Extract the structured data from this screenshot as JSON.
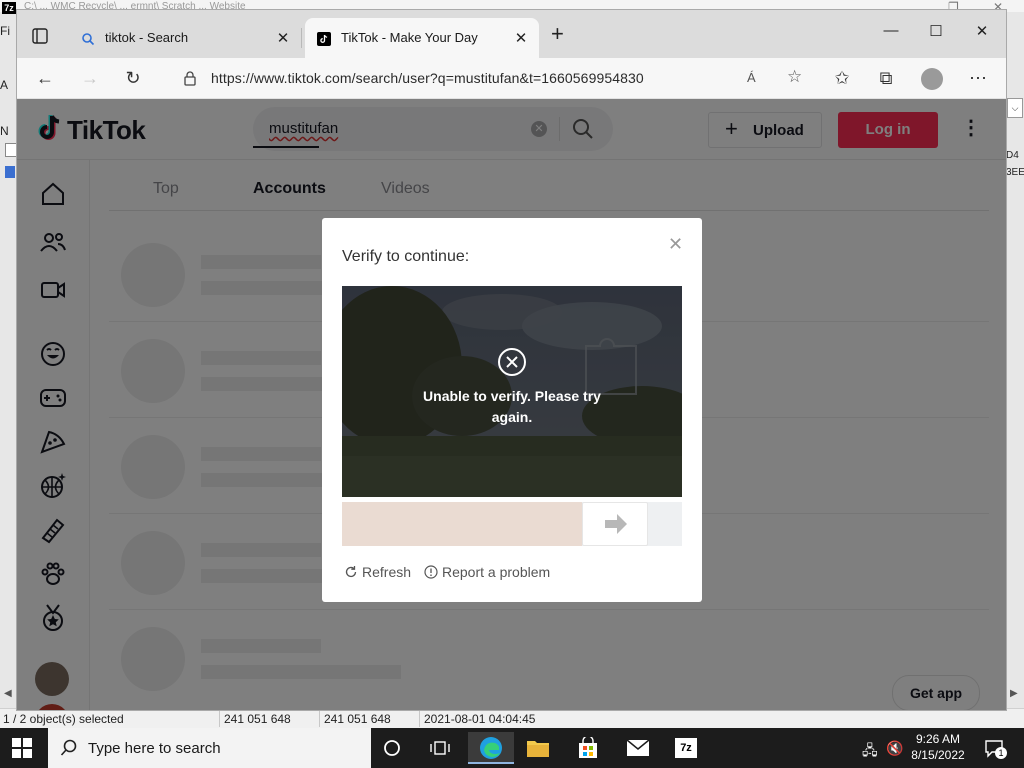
{
  "background_app": {
    "title": "C:\\ ... WMC Recycle\\ ... ermnt\\ Scratch ... Website",
    "left_fragments": [
      "Fi",
      "N",
      "A"
    ],
    "right_fragments": [
      "D4",
      "3EE"
    ],
    "status": {
      "selected": "1 / 2 object(s) selected",
      "size1": "241 051 648",
      "size2": "241 051 648",
      "modified": "2021-08-01 04:04:45"
    }
  },
  "browser": {
    "tabs": [
      {
        "label": "tiktok - Search",
        "icon": "search-icon"
      },
      {
        "label": "TikTok - Make Your Day",
        "icon": "tiktok-icon",
        "active": true
      }
    ],
    "url": "https://www.tiktok.com/search/user?q=mustitufan&t=1660569954830",
    "read_aloud": "Á"
  },
  "tiktok": {
    "logo_text": "TikTok",
    "search_value": "mustitufan",
    "upload_label": "Upload",
    "login_label": "Log in",
    "tabs": [
      "Top",
      "Accounts",
      "Videos"
    ],
    "active_tab": "Accounts",
    "get_app_label": "Get app",
    "side_icons": [
      "home-icon",
      "following-icon",
      "live-icon",
      "comedy-icon",
      "gaming-icon",
      "food-icon",
      "sports-icon",
      "beauty-icon",
      "animals-icon",
      "achievement-icon"
    ]
  },
  "modal": {
    "title": "Verify to continue:",
    "error_message": "Unable to verify. Please try again.",
    "refresh_label": "Refresh",
    "report_label": "Report a problem"
  },
  "taskbar": {
    "search_placeholder": "Type here to search",
    "time": "9:26 AM",
    "date": "8/15/2022",
    "notification_count": "1"
  }
}
